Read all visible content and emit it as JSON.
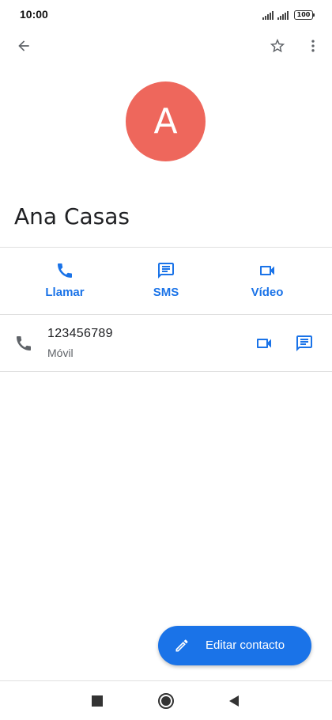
{
  "status_bar": {
    "time": "10:00",
    "battery": "100"
  },
  "app_bar": {
    "back_icon": "arrow-back-icon",
    "star_icon": "star-outline-icon",
    "menu_icon": "more-vert-icon"
  },
  "contact": {
    "initial": "A",
    "name": "Ana Casas",
    "avatar_color": "#ee675c"
  },
  "actions": [
    {
      "label": "Llamar",
      "icon": "phone-icon"
    },
    {
      "label": "SMS",
      "icon": "message-icon"
    },
    {
      "label": "Vídeo",
      "icon": "videocam-icon"
    }
  ],
  "phone_entry": {
    "number": "123456789",
    "type": "Móvil"
  },
  "fab": {
    "label": "Editar contacto",
    "icon": "edit-pencil-icon"
  },
  "colors": {
    "accent": "#1a73e8",
    "icon_gray": "#5f6368"
  }
}
